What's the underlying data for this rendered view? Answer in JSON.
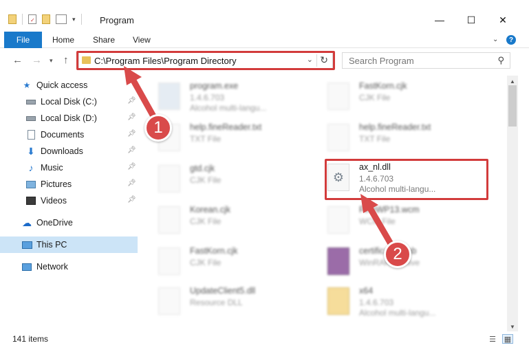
{
  "window": {
    "title": "Program",
    "controls": {
      "minimize": "—",
      "maximize": "☐",
      "close": "✕"
    }
  },
  "ribbon": {
    "tabs": [
      "File",
      "Home",
      "Share",
      "View"
    ]
  },
  "navigation": {
    "address_path": "C:\\Program Files\\Program Directory",
    "search_placeholder": "Search Program"
  },
  "sidebar": {
    "items": [
      {
        "label": "Quick access",
        "icon": "star-icon",
        "pinned": false
      },
      {
        "label": "Local Disk (C:)",
        "icon": "drive-icon",
        "pinned": true
      },
      {
        "label": "Local Disk (D:)",
        "icon": "drive-icon",
        "pinned": true
      },
      {
        "label": "Documents",
        "icon": "documents-icon",
        "pinned": true
      },
      {
        "label": "Downloads",
        "icon": "download-icon",
        "pinned": true
      },
      {
        "label": "Music",
        "icon": "music-icon",
        "pinned": true
      },
      {
        "label": "Pictures",
        "icon": "pictures-icon",
        "pinned": true
      },
      {
        "label": "Videos",
        "icon": "videos-icon",
        "pinned": true
      },
      {
        "label": "OneDrive",
        "icon": "cloud-icon",
        "pinned": false
      },
      {
        "label": "This PC",
        "icon": "computer-icon",
        "pinned": false,
        "selected": true
      },
      {
        "label": "Network",
        "icon": "network-icon",
        "pinned": false
      }
    ]
  },
  "files": [
    {
      "name": "program.exe",
      "meta1": "1.4.6.703",
      "meta2": "Alcohol multi-langu...",
      "blurred": true
    },
    {
      "name": "FastKorn.cjk",
      "meta1": "CJK File",
      "meta2": "",
      "blurred": true
    },
    {
      "name": "help.fineReader.txt",
      "meta1": "TXT File",
      "meta2": "",
      "blurred": true
    },
    {
      "name": "help.fineReader.txt",
      "meta1": "TXT File",
      "meta2": "",
      "blurred": true
    },
    {
      "name": "gtd.cjk",
      "meta1": "CJK File",
      "meta2": "",
      "blurred": true
    },
    {
      "name": "ax_nl.dll",
      "meta1": "1.4.6.703",
      "meta2": "Alcohol multi-langu...",
      "blurred": false
    },
    {
      "name": "Korean.cjk",
      "meta1": "CJK File",
      "meta2": "",
      "blurred": true
    },
    {
      "name": "FineWP13.wcm",
      "meta1": "WCM File",
      "meta2": "",
      "blurred": true
    },
    {
      "name": "FastKorn.cjk",
      "meta1": "CJK File",
      "meta2": "",
      "blurred": true
    },
    {
      "name": "certificates.cab",
      "meta1": "WinRAR archive",
      "meta2": "",
      "blurred": true
    },
    {
      "name": "UpdateClient5.dll",
      "meta1": "Resource DLL",
      "meta2": "",
      "blurred": true
    },
    {
      "name": "x64",
      "meta1": "1.4.6.703",
      "meta2": "Alcohol multi-langu...",
      "blurred": true
    }
  ],
  "status": {
    "item_count": "141 items"
  },
  "annotations": [
    {
      "number": "1"
    },
    {
      "number": "2"
    }
  ],
  "colors": {
    "accent": "#1979ca",
    "highlight": "#d23b3b",
    "selected_bg": "#cce4f7",
    "folder": "#e8c15a"
  }
}
